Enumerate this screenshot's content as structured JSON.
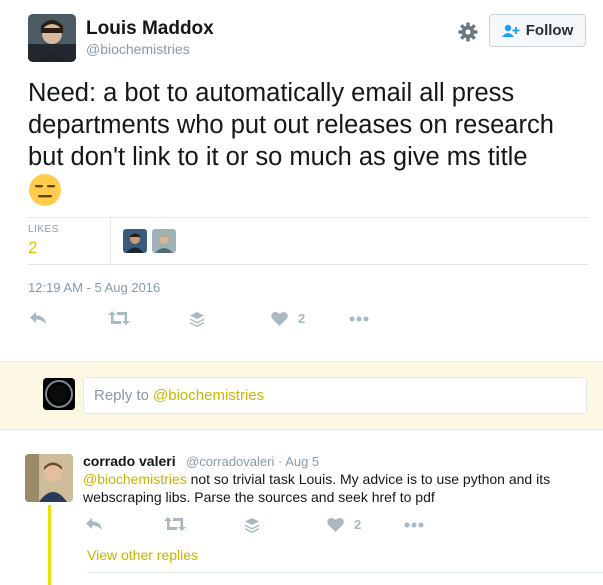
{
  "tweet": {
    "author_name": "Louis Maddox",
    "author_handle": "@biochemistries",
    "follow_label": "Follow",
    "text": "Need: a bot to automatically email all press departments who put out releases on research but don't link to it or so much as give ms title",
    "likes_label": "LIKES",
    "likes_count": "2",
    "timestamp": "12:19 AM - 5 Aug 2016",
    "action_like_count": "2"
  },
  "reply_box": {
    "prefix": "Reply to",
    "mention": "@biochemistries"
  },
  "reply": {
    "author_name": "corrado valeri",
    "author_handle": "@corradovaleri",
    "date": "· Aug 5",
    "mention": "@biochemistries",
    "text": "not so trivial task Louis. My advice is to use python and its webscraping libs. Parse the sources and seek href to pdf",
    "like_count": "2",
    "view_other_replies": "View other replies"
  },
  "colors": {
    "accent": "#c5b300",
    "icon_gray": "#aab8c2",
    "reply_bg": "#fcf8e3",
    "thread_line": "#e8e000"
  },
  "icons": [
    "gear-icon",
    "follow-person-icon",
    "reply-icon",
    "retweet-icon",
    "layers-icon",
    "heart-icon",
    "more-icon",
    "neutral-face-emoji"
  ]
}
